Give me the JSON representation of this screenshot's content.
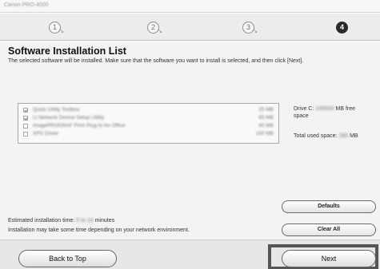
{
  "window": {
    "title": "Canon PRO-4000"
  },
  "steps": [
    {
      "label": "1",
      "active": false
    },
    {
      "label": "2",
      "active": false
    },
    {
      "label": "3",
      "active": false
    },
    {
      "label": "4",
      "active": true
    }
  ],
  "header": {
    "title": "Software Installation List",
    "description": "The selected software will be installed. Make sure that the software you want to install is selected, and then click [Next]."
  },
  "software_list": [
    {
      "name": "Quick Utility Toolbox",
      "size": "25 MB",
      "checked": true
    },
    {
      "name": "LI Network Device Setup Utility",
      "size": "65 MB",
      "checked": true
    },
    {
      "name": "imagePROGRAF Print Plug-In for Office",
      "size": "40 MB",
      "checked": false
    },
    {
      "name": "XPS Driver",
      "size": "150 MB",
      "checked": false
    }
  ],
  "disk": {
    "drive_prefix": "Drive C:",
    "drive_free_value": "100000",
    "drive_suffix": "MB free",
    "drive_suffix2": "space",
    "used_prefix": "Total used space:",
    "used_value": "280",
    "used_suffix": "MB"
  },
  "estimate": {
    "prefix": "Estimated installation time:",
    "value": "5 to 10",
    "suffix": "minutes",
    "note": "Installation may take some time depending on your network environment."
  },
  "buttons": {
    "defaults": "Defaults",
    "clear_all": "Clear All",
    "back_to_top": "Back to Top",
    "next": "Next"
  }
}
